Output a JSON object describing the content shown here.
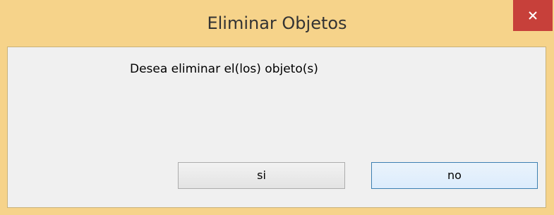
{
  "window": {
    "title": "Eliminar Objetos",
    "close_icon": "close-icon"
  },
  "dialog": {
    "message": "Desea eliminar el(los) objeto(s)",
    "yes_label": "si",
    "no_label": "no"
  },
  "colors": {
    "titlebar": "#f6d38a",
    "close_button": "#c7403a",
    "client_background": "#f0f0f0",
    "default_button_border": "#3c7fb1"
  }
}
